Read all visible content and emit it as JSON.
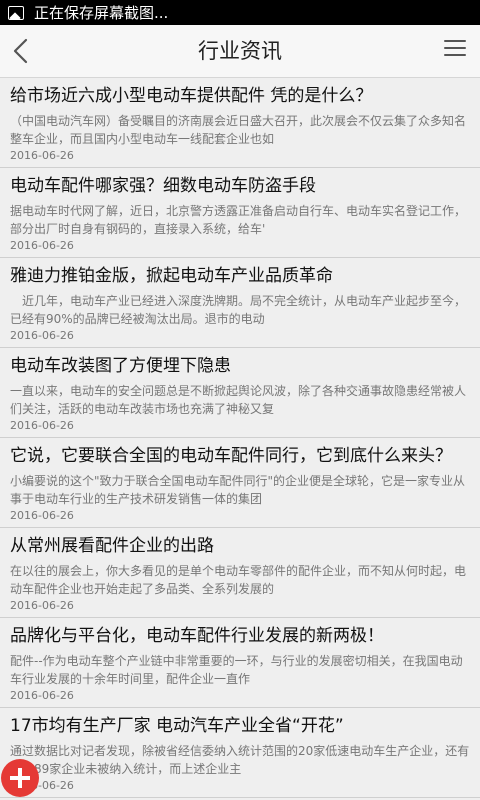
{
  "status_bar": {
    "text": "正在保存屏幕截图..."
  },
  "header": {
    "title": "行业资讯"
  },
  "articles": [
    {
      "title": "给市场近六成小型电动车提供配件 凭的是什么？",
      "summary": "（中国电动汽车网）备受瞩目的济南展会近日盛大召开，此次展会不仅云集了众多知名整车企业，而且国内小型电动车一线配套企业也如",
      "date": "2016-06-26"
    },
    {
      "title": "电动车配件哪家强？细数电动车防盗手段",
      "summary": "据电动车时代网了解，近日，北京警方透露正准备启动自行车、电动车实名登记工作，部分出厂时自身有钢码的，直接录入系统，给车'",
      "date": "2016-06-26"
    },
    {
      "title": "雅迪力推铂金版，掀起电动车产业品质革命",
      "summary": "　近几年，电动车产业已经进入深度洗牌期。局不完全统计，从电动车产业起步至今，已经有90%的品牌已经被淘汰出局。退市的电动",
      "date": "2016-06-26"
    },
    {
      "title": "电动车改装图了方便埋下隐患",
      "summary": "一直以来，电动车的安全问题总是不断掀起舆论风波，除了各种交通事故隐患经常被人们关注，活跃的电动车改装市场也充满了神秘又复",
      "date": "2016-06-26"
    },
    {
      "title": "它说，它要联合全国的电动车配件同行，它到底什么来头？",
      "summary": "小编要说的这个\"致力于联合全国电动车配件同行\"的企业便是全球轮，它是一家专业从事于电动车行业的生产技术研发销售一体的集团",
      "date": "2016-06-26"
    },
    {
      "title": "从常州展看配件企业的出路",
      "summary": "在以往的展会上，你大多看见的是单个电动车零部件的配件企业，而不知从何时起，电动车配件企业也开始走起了多品类、全系列发展的",
      "date": "2016-06-26"
    },
    {
      "title": "品牌化与平台化，电动车配件行业发展的新两极！",
      "summary": "配件--作为电动车整个产业链中非常重要的一环，与行业的发展密切相关，在我国电动车行业发展的十余年时间里，配件企业一直作",
      "date": "2016-06-26"
    },
    {
      "title": "17市均有生产厂家 电动汽车产业全省“开花”",
      "summary": "通过数据比对记者发现，除被省经信委纳入统计范围的20家低速电动车生产企业，还有至少89家企业未被纳入统计，而上述企业主",
      "date": "2016-06-26"
    }
  ]
}
